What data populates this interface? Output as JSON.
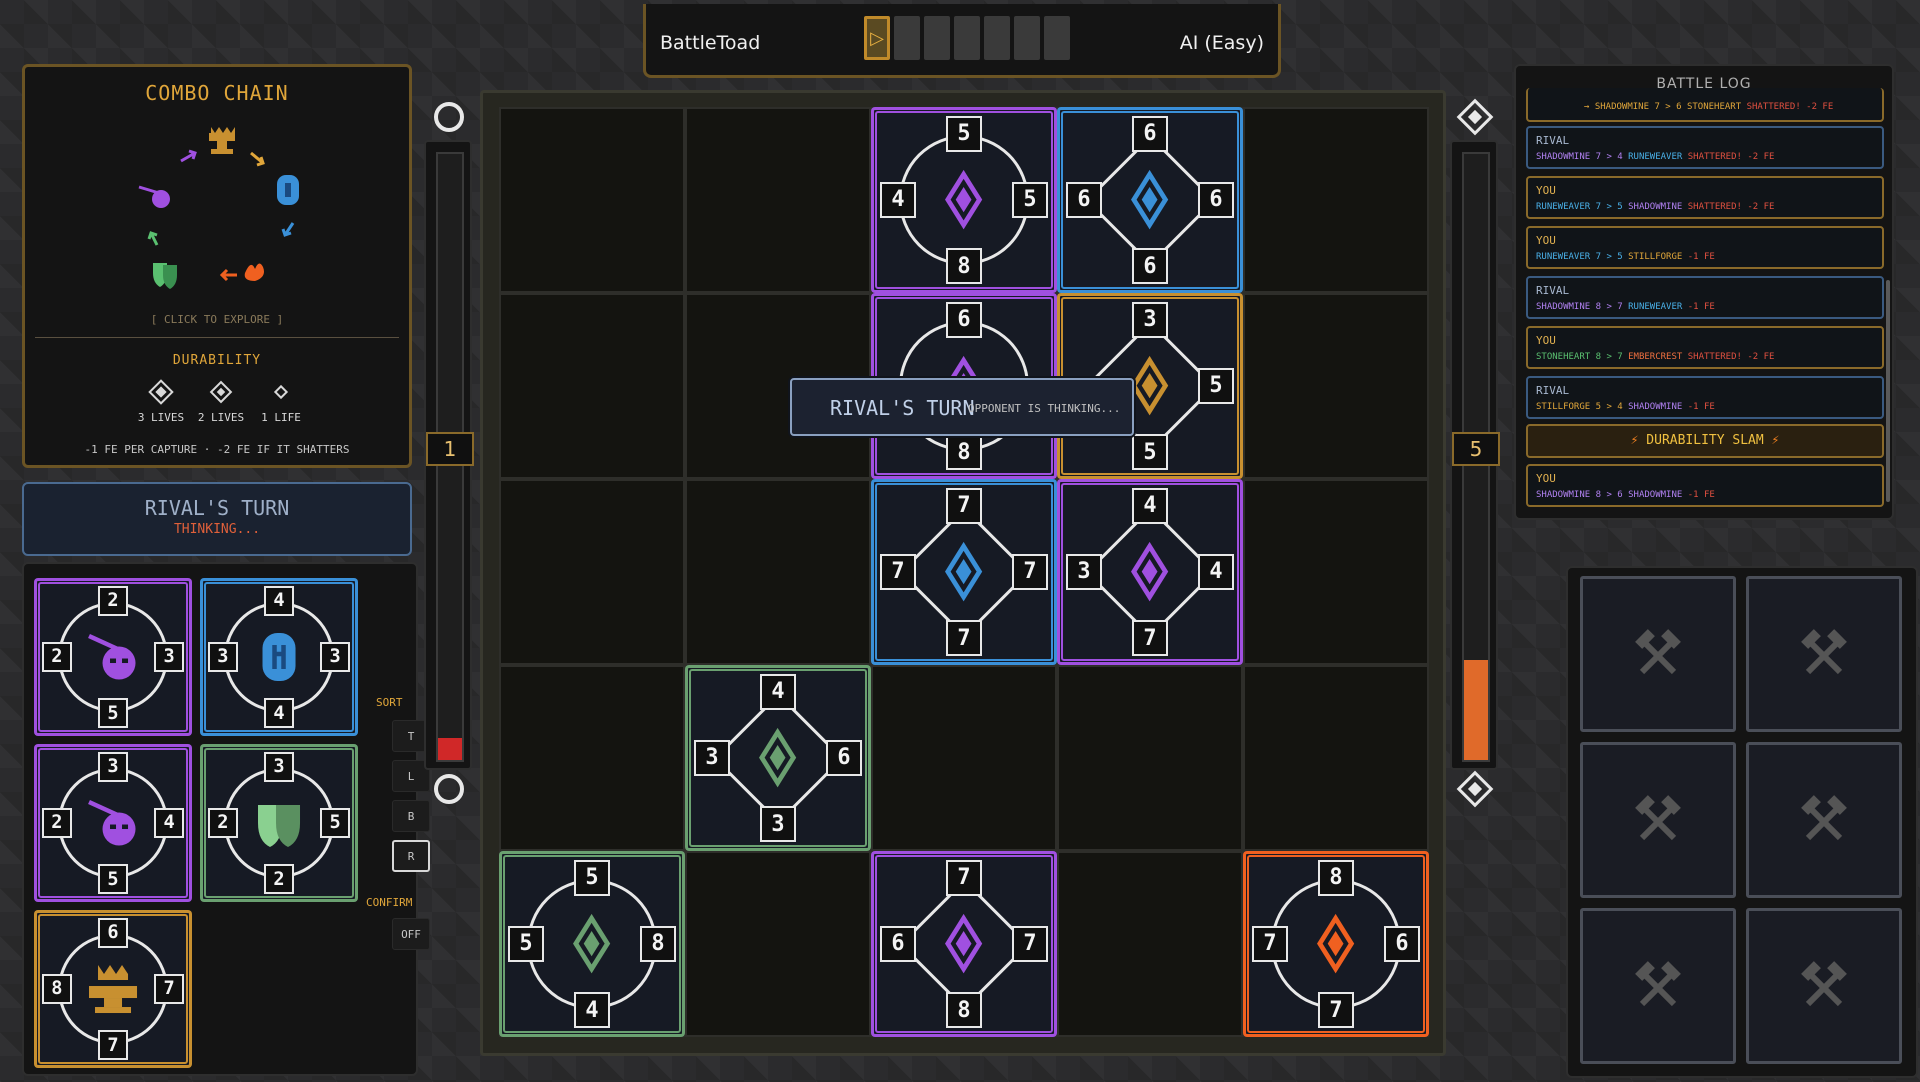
{
  "topbar": {
    "player": "BattleToad",
    "opponent": "AI (Easy)",
    "turn_marker": "▷"
  },
  "combo": {
    "title": "COMBO CHAIN",
    "explore": "[ CLICK TO EXPLORE ]",
    "durability_title": "DURABILITY",
    "lives": [
      "3 LIVES",
      "2 LIVES",
      "1 LIFE"
    ],
    "rule": "-1 FE PER CAPTURE · -2 FE IF IT SHATTERS"
  },
  "rival_panel": {
    "title": "RIVAL'S TURN",
    "status": "THINKING..."
  },
  "sort": {
    "label": "SORT",
    "buttons": [
      "T",
      "L",
      "B",
      "R"
    ],
    "confirm_label": "CONFIRM",
    "confirm_value": "OFF"
  },
  "meters": {
    "left_value": "1",
    "right_value": "5"
  },
  "tooltip": {
    "title": "RIVAL'S TURN",
    "text": "OPPONENT IS THINKING..."
  },
  "colors": {
    "shadow": "#a050e0",
    "rune": "#3a90d8",
    "stone": "#6aa070",
    "ember": "#f06020",
    "still": "#c89030"
  },
  "hand": [
    {
      "faction": "shadow",
      "top": "2",
      "left": "2",
      "right": "3",
      "bottom": "5",
      "shape": "circle",
      "icon": "pickaxe-mask-icon"
    },
    {
      "faction": "rune",
      "top": "4",
      "left": "3",
      "right": "3",
      "bottom": "4",
      "shape": "circle",
      "icon": "runestone-icon"
    },
    {
      "faction": "shadow",
      "top": "3",
      "left": "2",
      "right": "4",
      "bottom": "5",
      "shape": "circle",
      "icon": "pickaxe-mask-icon"
    },
    {
      "faction": "stone",
      "top": "3",
      "left": "2",
      "right": "5",
      "bottom": "2",
      "shape": "circle",
      "icon": "shields-icon"
    },
    {
      "faction": "still",
      "top": "6",
      "left": "8",
      "right": "7",
      "bottom": "7",
      "shape": "circle",
      "icon": "anvil-crown-icon"
    }
  ],
  "board": [
    {
      "row": 0,
      "col": 2,
      "faction": "shadow",
      "top": "5",
      "left": "4",
      "right": "5",
      "bottom": "8",
      "shape": "circle"
    },
    {
      "row": 0,
      "col": 3,
      "faction": "rune",
      "top": "6",
      "left": "6",
      "right": "6",
      "bottom": "6",
      "shape": "diamond"
    },
    {
      "row": 1,
      "col": 2,
      "faction": "shadow",
      "top": "6",
      "left": "",
      "right": "",
      "bottom": "8",
      "shape": "circle"
    },
    {
      "row": 1,
      "col": 3,
      "faction": "still",
      "top": "3",
      "left": "",
      "right": "5",
      "bottom": "5",
      "shape": "diamond"
    },
    {
      "row": 2,
      "col": 2,
      "faction": "rune",
      "top": "7",
      "left": "7",
      "right": "7",
      "bottom": "7",
      "shape": "diamond"
    },
    {
      "row": 2,
      "col": 3,
      "faction": "shadow",
      "top": "4",
      "left": "3",
      "right": "4",
      "bottom": "7",
      "shape": "diamond"
    },
    {
      "row": 3,
      "col": 1,
      "faction": "stone",
      "top": "4",
      "left": "3",
      "right": "6",
      "bottom": "3",
      "shape": "diamond"
    },
    {
      "row": 4,
      "col": 0,
      "faction": "stone",
      "top": "5",
      "left": "5",
      "right": "8",
      "bottom": "4",
      "shape": "circle"
    },
    {
      "row": 4,
      "col": 2,
      "faction": "shadow",
      "top": "7",
      "left": "6",
      "right": "7",
      "bottom": "8",
      "shape": "diamond"
    },
    {
      "row": 4,
      "col": 4,
      "faction": "ember",
      "top": "8",
      "left": "7",
      "right": "6",
      "bottom": "7",
      "shape": "circle"
    }
  ],
  "battle_log": {
    "title": "BATTLE LOG",
    "partial": {
      "a": "→ SHADOWMINE 7 > 6 STONEHEART",
      "b": "SHATTERED! -2 FE"
    },
    "entries": [
      {
        "who": "RIVAL",
        "a": "SHADOWMINE 7 > 4",
        "a_c": "shadow",
        "b": "RUNEWEAVER",
        "b_c": "rune",
        "c": "SHATTERED! -2 FE",
        "c_c": "red"
      },
      {
        "who": "YOU",
        "a": "RUNEWEAVER 7 > 5",
        "a_c": "rune",
        "b": "SHADOWMINE",
        "b_c": "shadow",
        "c": "SHATTERED! -2 FE",
        "c_c": "red"
      },
      {
        "who": "YOU",
        "a": "RUNEWEAVER 7 > 5",
        "a_c": "rune",
        "b": "STILLFORGE",
        "b_c": "still",
        "c": "-1 FE",
        "c_c": "red"
      },
      {
        "who": "RIVAL",
        "a": "SHADOWMINE 8 > 7",
        "a_c": "shadow",
        "b": "RUNEWEAVER",
        "b_c": "rune",
        "c": "-1 FE",
        "c_c": "red"
      },
      {
        "who": "YOU",
        "a": "STONEHEART 8 > 7",
        "a_c": "stone",
        "b": "EMBERCREST",
        "b_c": "ember",
        "c": "SHATTERED! -2 FE",
        "c_c": "red"
      },
      {
        "who": "RIVAL",
        "a": "STILLFORGE 5 > 4",
        "a_c": "still",
        "b": "SHADOWMINE",
        "b_c": "shadow",
        "c": "-1 FE",
        "c_c": "red"
      }
    ],
    "slam": "DURABILITY SLAM",
    "last": {
      "who": "YOU",
      "a": "SHADOWMINE 8 > 6",
      "a_c": "shadow",
      "b": "SHADOWMINE",
      "b_c": "shadow",
      "c": "-1 FE",
      "c_c": "red"
    }
  },
  "graveyard": {
    "slots": 6,
    "icon": "crossed-hammers-icon"
  }
}
